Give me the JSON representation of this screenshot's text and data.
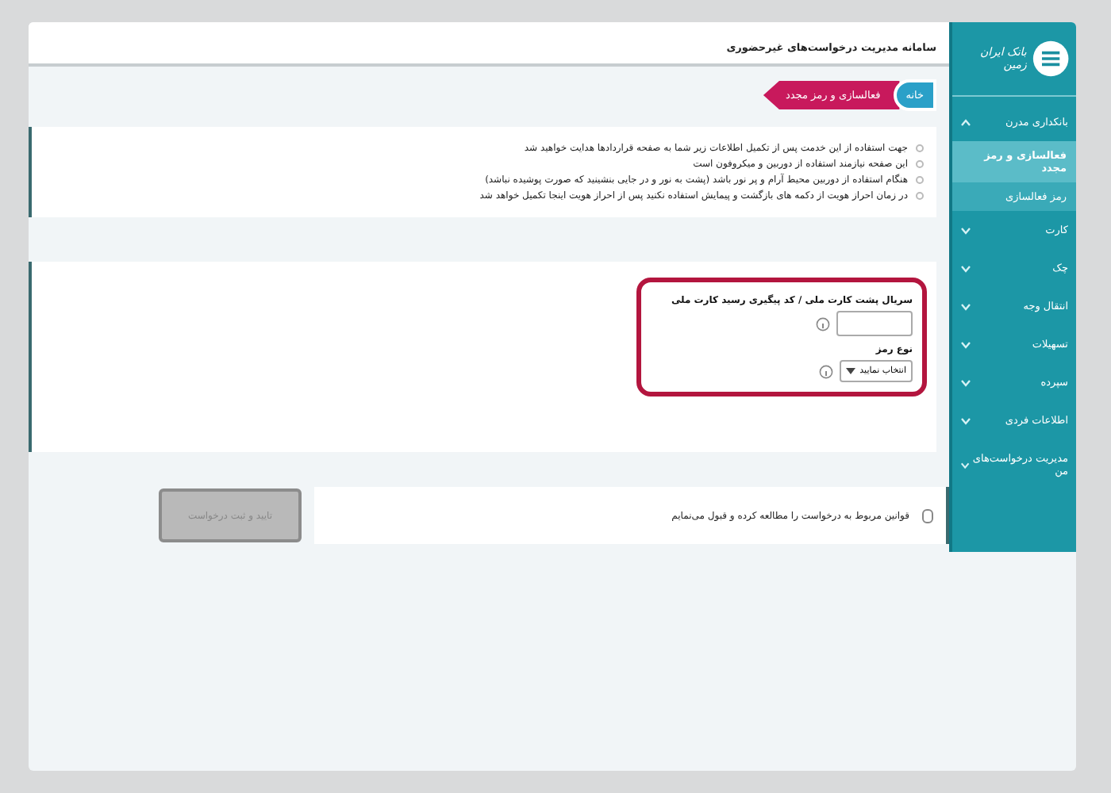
{
  "page_title": "سامانه مدیریت درخواست‌های غیرحضوری",
  "breadcrumb": [
    {
      "label": "خانه",
      "kind": "home"
    },
    {
      "label": "فعالسازی و رمز مجدد",
      "kind": "current"
    }
  ],
  "instructions": [
    "جهت استفاده از این خدمت پس از تکمیل اطلاعات زیر شما به صفحه قراردادها هدایت خواهید شد",
    "این صفحه نیازمند استفاده از دوربین و میکروفون است",
    "هنگام استفاده از دوربین محیط آرام و پر نور باشد (پشت به نور و در جایی بنشینید که صورت پوشیده نباشد)",
    "در زمان احراز هویت از دکمه های بازگشت و پیمایش استفاده نکنید پس از احراز هویت اینجا تکمیل خواهد شد"
  ],
  "form": {
    "fields": [
      {
        "label": "سریال پشت کارت ملی / کد پیگیری رسید کارت ملی",
        "kind": "input"
      },
      {
        "label": "نوع رمز",
        "kind": "select",
        "value": "انتخاب نمایید"
      }
    ]
  },
  "terms": {
    "label": "قوانین مربوط به درخواست را مطالعه کرده و قبول می‌نمایم",
    "checked": false
  },
  "submit": {
    "label": "تایید و ثبت درخواست",
    "disabled": true
  },
  "sidebar": {
    "logo_text": "بانک ایران زمین",
    "items": [
      {
        "label": "بانکداری مدرن",
        "expanded": true,
        "children": [
          {
            "label": "فعالسازی و رمز مجدد",
            "selected": true
          },
          {
            "label": "رمز فعالسازی",
            "selected": false
          }
        ]
      },
      {
        "label": "کارت",
        "expanded": false
      },
      {
        "label": "چک",
        "expanded": false
      },
      {
        "label": "انتقال وجه",
        "expanded": false
      },
      {
        "label": "تسهیلات",
        "expanded": false
      },
      {
        "label": "سپرده",
        "expanded": false
      },
      {
        "label": "اطلاعات فردی",
        "expanded": false
      },
      {
        "label": "مدیریت درخواست‌های من",
        "expanded": false
      }
    ]
  }
}
